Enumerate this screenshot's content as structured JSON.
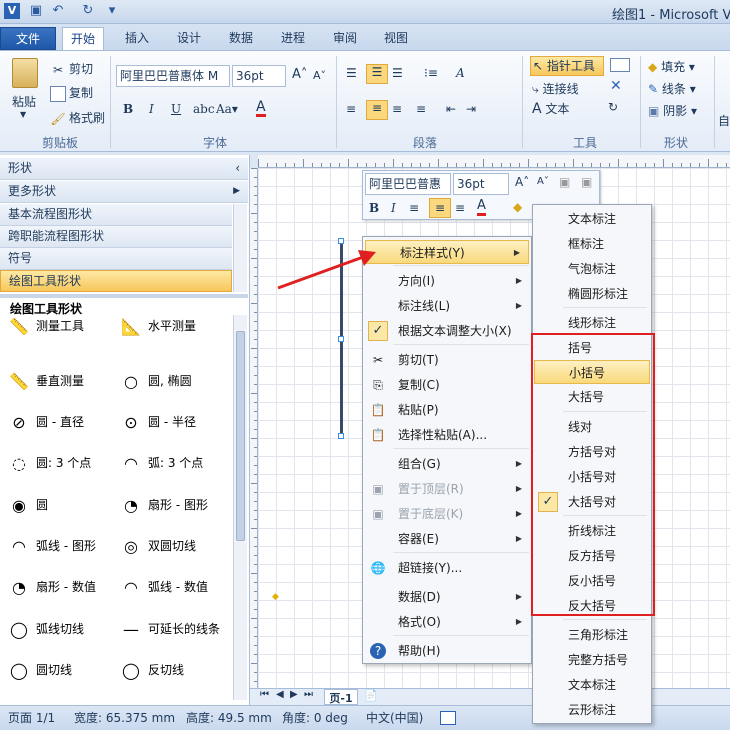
{
  "window": {
    "title": "绘图1 - Microsoft V"
  },
  "qat": {
    "save_icon": "save-icon",
    "undo_icon": "undo-icon",
    "redo_icon": "redo-icon",
    "customize_icon": "customize-qat-icon"
  },
  "tabs": [
    {
      "label": "文件"
    },
    {
      "label": "开始"
    },
    {
      "label": "插入"
    },
    {
      "label": "设计"
    },
    {
      "label": "数据"
    },
    {
      "label": "进程"
    },
    {
      "label": "审阅"
    },
    {
      "label": "视图"
    }
  ],
  "ribbon": {
    "clipboard": {
      "paste": "粘贴",
      "cut": "剪切",
      "copy": "复制",
      "format_painter": "格式刷",
      "label": "剪贴板"
    },
    "font": {
      "font_name": "阿里巴巴普惠体 M",
      "font_size": "36pt",
      "label": "字体"
    },
    "paragraph": {
      "label": "段落"
    },
    "tools": {
      "pointer": "指针工具",
      "connector": "连接线",
      "text": "文本",
      "label": "工具"
    },
    "shape": {
      "fill": "填充",
      "line": "线条",
      "shadow": "阴影",
      "label": "形状"
    },
    "arrange_hint": "自"
  },
  "shapes_pane": {
    "title": "形状",
    "more": "更多形状",
    "stencils": [
      "基本流程图形状",
      "跨职能流程图形状",
      "符号",
      "绘图工具形状"
    ],
    "section": "绘图工具形状",
    "items": [
      "测量工具",
      "水平测量",
      "垂直测量",
      "圆, 椭圆",
      "圆 - 直径",
      "圆 - 半径",
      "圆: 3 个点",
      "弧: 3 个点",
      "圆",
      "扇形 - 图形",
      "弧线 - 图形",
      "双圆切线",
      "扇形 - 数值",
      "弧线 - 数值",
      "弧线切线",
      "可延长的线条",
      "圆切线",
      "反切线"
    ]
  },
  "minibar": {
    "font_name": "阿里巴巴普惠",
    "font_size": "36pt"
  },
  "context_menu": {
    "items": [
      {
        "label": "标注样式(Y)",
        "arrow": true
      },
      {
        "label": "方向(I)",
        "arrow": true
      },
      {
        "label": "标注线(L)",
        "arrow": true
      },
      {
        "label": "根据文本调整大小(X)",
        "checked": true
      },
      {
        "label": "剪切(T)"
      },
      {
        "label": "复制(C)"
      },
      {
        "label": "粘贴(P)"
      },
      {
        "label": "选择性粘贴(A)..."
      },
      {
        "label": "组合(G)",
        "arrow": true
      },
      {
        "label": "置于顶层(R)",
        "arrow": true,
        "disabled": true
      },
      {
        "label": "置于底层(K)",
        "arrow": true,
        "disabled": true
      },
      {
        "label": "容器(E)",
        "arrow": true
      },
      {
        "label": "超链接(Y)..."
      },
      {
        "label": "数据(D)",
        "arrow": true
      },
      {
        "label": "格式(O)",
        "arrow": true
      },
      {
        "label": "帮助(H)"
      }
    ]
  },
  "callout_submenu": {
    "items": [
      "文本标注",
      "框标注",
      "气泡标注",
      "椭圆形标注",
      "线形标注",
      "括号",
      "小括号",
      "大括号",
      "线对",
      "方括号对",
      "小括号对",
      "大括号对",
      "折线标注",
      "反方括号",
      "反小括号",
      "反大括号",
      "三角形标注",
      "完整方括号",
      "文本标注",
      "云形标注"
    ],
    "highlighted": "小括号",
    "checked": "大括号对"
  },
  "page_tabs": {
    "page": "页-1"
  },
  "status": {
    "page": "页面 1/1",
    "width": "宽度: 65.375 mm",
    "height": "高度: 49.5 mm",
    "angle": "角度: 0 deg",
    "lang": "中文(中国)"
  },
  "colors": {
    "accent": "#e02020",
    "highlight": "#f9d97c",
    "file_tab": "#2a63b4"
  }
}
